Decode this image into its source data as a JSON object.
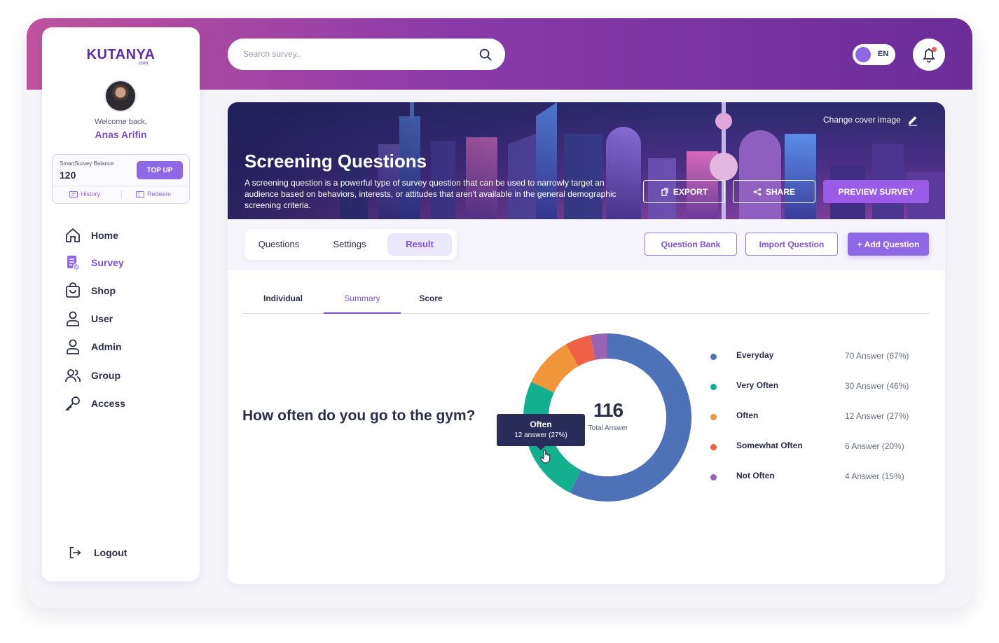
{
  "brand": {
    "name": "KUTANYA",
    "suffix": ".com"
  },
  "user": {
    "welcome": "Welcome back,",
    "name": "Anas Arifin"
  },
  "balance": {
    "label": "SmartSurvey Balance",
    "value": "120",
    "topup_label": "TOP UP",
    "history_label": "History",
    "redeem_label": "Redeem"
  },
  "nav": [
    {
      "label": "Home",
      "icon": "home-icon"
    },
    {
      "label": "Survey",
      "icon": "survey-icon",
      "active": true
    },
    {
      "label": "Shop",
      "icon": "shop-icon"
    },
    {
      "label": "User",
      "icon": "user-icon"
    },
    {
      "label": "Admin",
      "icon": "admin-icon"
    },
    {
      "label": "Group",
      "icon": "group-icon"
    },
    {
      "label": "Access",
      "icon": "key-icon"
    }
  ],
  "logout_label": "Logout",
  "search": {
    "placeholder": "Search survey.."
  },
  "language": "EN",
  "cover": {
    "change_label": "Change cover image",
    "title": "Screening Questions",
    "description": "A screening question is a powerful type of survey question that can be used to narrowly target an audience based on behaviors, interests, or attitudes that aren't available in the general demographic screening criteria.",
    "export_label": "EXPORT",
    "share_label": "SHARE",
    "preview_label": "PREVIEW SURVEY"
  },
  "tabs": [
    {
      "label": "Questions"
    },
    {
      "label": "Settings"
    },
    {
      "label": "Result",
      "active": true
    }
  ],
  "actions": {
    "question_bank": "Question Bank",
    "import_question": "Import Question",
    "add_question": "+ Add Question"
  },
  "subtabs": [
    {
      "label": "Individual"
    },
    {
      "label": "Summary",
      "active": true
    },
    {
      "label": "Score"
    }
  ],
  "question": "How often do you go to the gym?",
  "chart_data": {
    "type": "pie",
    "center_value": "116",
    "center_label": "Total Answer",
    "slices": [
      {
        "label": "Everyday",
        "count": 70,
        "value_text": "70  Answer (67%)",
        "color": "#4e72b8"
      },
      {
        "label": "Very Often",
        "count": 30,
        "value_text": "30  Answer (46%)",
        "color": "#13b08f"
      },
      {
        "label": "Often",
        "count": 12,
        "value_text": "12  Answer (27%)",
        "color": "#f0953a"
      },
      {
        "label": "Somewhat Often",
        "count": 6,
        "value_text": "6 Answer (20%)",
        "color": "#ef6146"
      },
      {
        "label": "Not Often",
        "count": 4,
        "value_text": "4 Answer (15%)",
        "color": "#9a64b4"
      }
    ],
    "tooltip": {
      "title": "Often",
      "text": "12 answer (27%)"
    }
  },
  "colors": {
    "accent": "#8f68e6",
    "header_gradient_start": "#c0539e",
    "header_gradient_end": "#6a2d9a",
    "text": "#2c2f4a"
  }
}
